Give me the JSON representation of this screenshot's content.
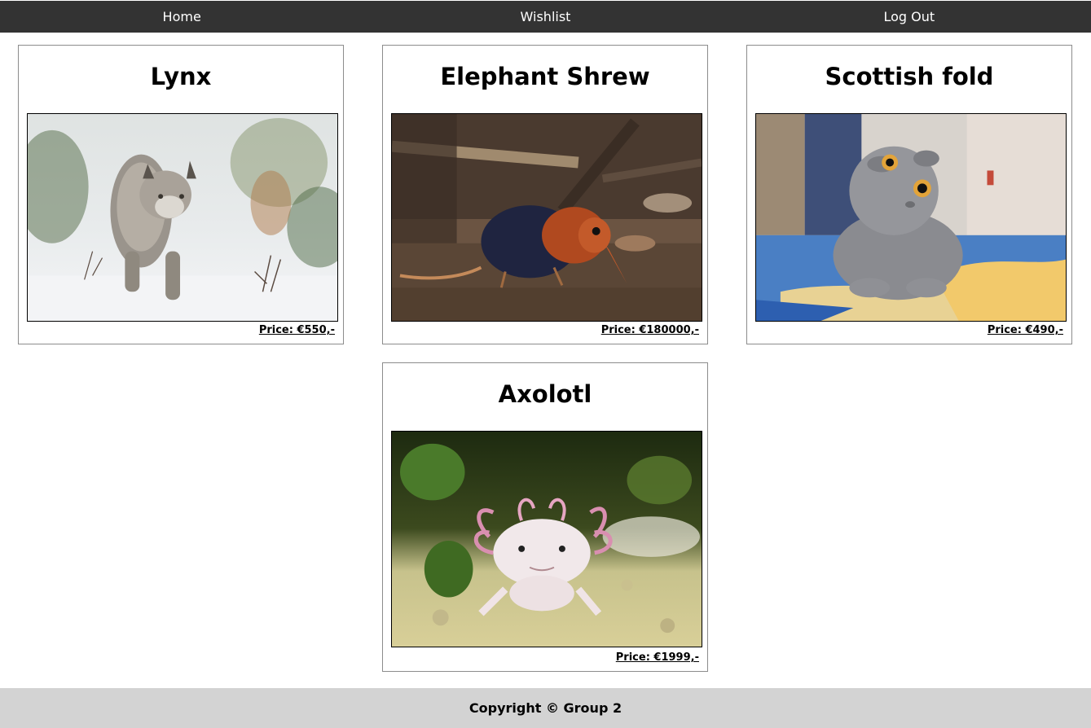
{
  "nav": {
    "items": [
      {
        "label": "Home"
      },
      {
        "label": "Wishlist"
      },
      {
        "label": "Log Out"
      }
    ],
    "background": "#333333"
  },
  "products": [
    {
      "name": "Lynx",
      "price": "Price: €550,-",
      "image": "lynx-photo"
    },
    {
      "name": "Elephant Shrew",
      "price": "Price: €180000,-",
      "image": "elephant-shrew-photo"
    },
    {
      "name": "Scottish fold",
      "price": "Price: €490,-",
      "image": "scottish-fold-photo"
    },
    {
      "name": "Axolotl",
      "price": "Price: €1999,-",
      "image": "axolotl-photo"
    }
  ],
  "footer": {
    "text": "Copyright © Group 2",
    "background": "#d3d3d3"
  }
}
